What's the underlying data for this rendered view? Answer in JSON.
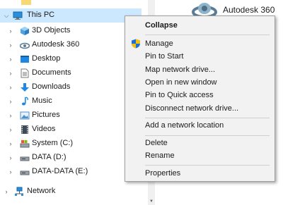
{
  "nav": {
    "this_pc": "This PC",
    "items": [
      {
        "label": "3D Objects",
        "icon": "3d-objects-icon"
      },
      {
        "label": "Autodesk 360",
        "icon": "autodesk-360-icon"
      },
      {
        "label": "Desktop",
        "icon": "desktop-icon"
      },
      {
        "label": "Documents",
        "icon": "documents-icon"
      },
      {
        "label": "Downloads",
        "icon": "downloads-icon"
      },
      {
        "label": "Music",
        "icon": "music-icon"
      },
      {
        "label": "Pictures",
        "icon": "pictures-icon"
      },
      {
        "label": "Videos",
        "icon": "videos-icon"
      },
      {
        "label": "System (C:)",
        "icon": "system-drive-icon"
      },
      {
        "label": "DATA (D:)",
        "icon": "data-drive-icon"
      },
      {
        "label": "DATA-DATA (E:)",
        "icon": "data-data-drive-icon"
      }
    ],
    "network": "Network"
  },
  "content": {
    "item_label": "Autodesk 360"
  },
  "context_menu": {
    "collapse": "Collapse",
    "manage": "Manage",
    "pin_to_start": "Pin to Start",
    "map_network_drive": "Map network drive...",
    "open_in_new_window": "Open in new window",
    "pin_to_quick_access": "Pin to Quick access",
    "disconnect_network_drive": "Disconnect network drive...",
    "add_network_location": "Add a network location",
    "delete": "Delete",
    "rename": "Rename",
    "properties": "Properties"
  },
  "colors": {
    "selection": "#cce8ff",
    "menu_bg": "#f2f2f2",
    "folder": "#f8d775",
    "accent_blue": "#1e88e5"
  }
}
